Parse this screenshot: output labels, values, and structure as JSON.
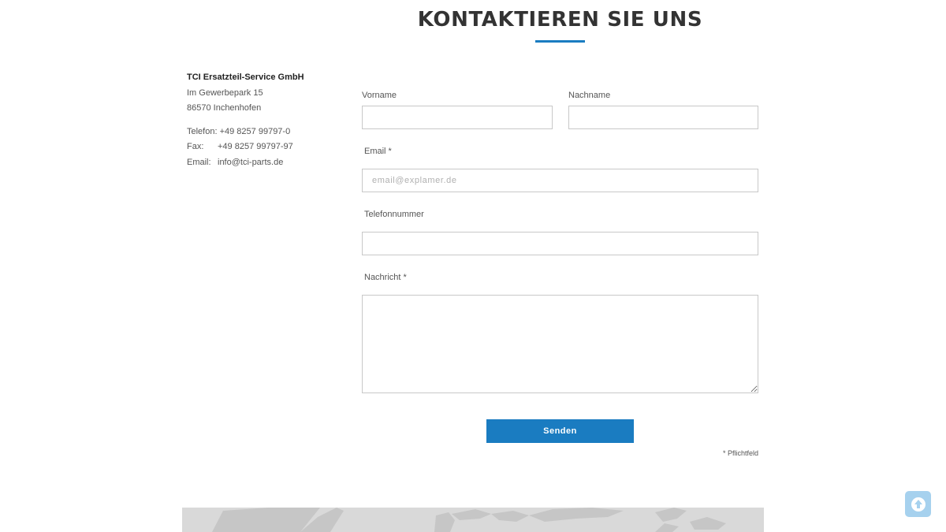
{
  "heading": {
    "title": "KONTAKTIEREN SIE UNS"
  },
  "address": {
    "company": "TCI Ersatzteil-Service GmbH",
    "street": "Im Gewerbepark 15",
    "city": "86570 Inchenhofen",
    "phone_label": "Telefon:",
    "phone": "+49 8257 99797-0",
    "fax_label": "Fax:",
    "fax": "+49 8257 99797-97",
    "email_label": "Email:",
    "email": "info@tci-parts.de"
  },
  "form": {
    "firstname_label": "Vorname",
    "lastname_label": "Nachname",
    "email_label": "Email *",
    "email_placeholder": "email@explamer.de",
    "phone_label": "Telefonnummer",
    "message_label": "Nachricht *",
    "submit_label": "Senden",
    "required_note": "* Pflichtfeld"
  },
  "icons": {
    "scroll_top": "arrow-up-circle-icon"
  },
  "colors": {
    "accent": "#1a7cc1",
    "scroll_button": "#a6d1ee",
    "map_background": "#d9d9d9"
  }
}
